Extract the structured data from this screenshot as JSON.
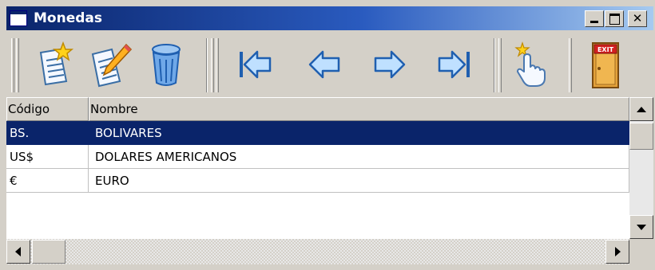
{
  "window": {
    "title": "Monedas"
  },
  "toolbar": {
    "buttons": [
      {
        "name": "new-record",
        "icon": "new-document-star-icon"
      },
      {
        "name": "edit-record",
        "icon": "edit-document-pencil-icon"
      },
      {
        "name": "delete-record",
        "icon": "trash-can-icon"
      },
      {
        "name": "first-record",
        "icon": "arrow-first-icon"
      },
      {
        "name": "previous-record",
        "icon": "arrow-left-icon"
      },
      {
        "name": "next-record",
        "icon": "arrow-right-icon"
      },
      {
        "name": "last-record",
        "icon": "arrow-last-icon"
      },
      {
        "name": "select-record",
        "icon": "hand-pointer-icon"
      },
      {
        "name": "exit",
        "icon": "exit-door-icon",
        "badge": "EXIT"
      }
    ]
  },
  "grid": {
    "columns": [
      "Código",
      "Nombre"
    ],
    "rows": [
      {
        "codigo": "BS.",
        "nombre": "BOLIVARES",
        "selected": true
      },
      {
        "codigo": "US$",
        "nombre": "DOLARES AMERICANOS",
        "selected": false
      },
      {
        "codigo": "€",
        "nombre": "EURO",
        "selected": false
      }
    ]
  },
  "colors": {
    "selection": "#0a246a",
    "titlebar_start": "#0a246a",
    "titlebar_end": "#a6caf0",
    "face": "#d4d0c8"
  }
}
